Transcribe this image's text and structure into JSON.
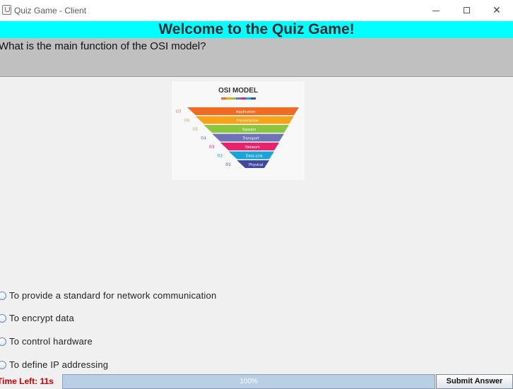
{
  "window": {
    "title": "Quiz Game - Client",
    "controls": {
      "minimize": "—",
      "maximize": "☐",
      "close": "✕"
    }
  },
  "header": {
    "title": "Welcome to the Quiz Game!",
    "background": "#00ffff"
  },
  "question": {
    "text": "What is the main function of the OSI model?",
    "image": {
      "title": "OSI MODEL",
      "layers": [
        {
          "num": "07",
          "name": "Application",
          "color": "#f06a22"
        },
        {
          "num": "06",
          "name": "Presentation",
          "color": "#f7a21b"
        },
        {
          "num": "05",
          "name": "Session",
          "color": "#8cc63f"
        },
        {
          "num": "04",
          "name": "Transport",
          "color": "#6f73b5"
        },
        {
          "num": "03",
          "name": "Network",
          "color": "#e8236b"
        },
        {
          "num": "02",
          "name": "Data-Link",
          "color": "#1aa3d8"
        },
        {
          "num": "01",
          "name": "Physical",
          "color": "#3f4a9c"
        }
      ]
    }
  },
  "options": [
    {
      "label": "To provide a standard for network communication"
    },
    {
      "label": "To encrypt data"
    },
    {
      "label": "To control hardware"
    },
    {
      "label": "To define IP addressing"
    }
  ],
  "footer": {
    "timer_text": "Time Left: 11s",
    "progress": 100,
    "progress_text": "100%",
    "submit_label": "Submit Answer"
  }
}
